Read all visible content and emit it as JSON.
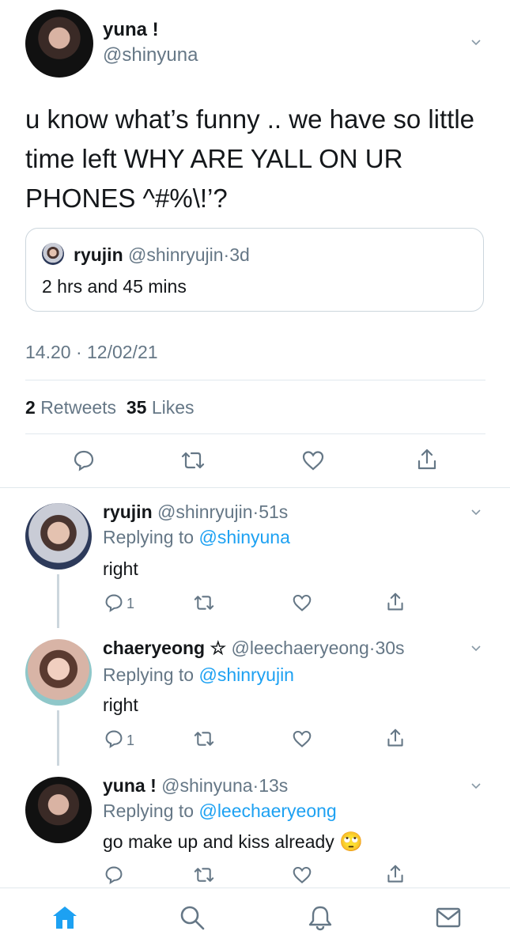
{
  "main_tweet": {
    "author_name": "yuna !",
    "author_handle": "@shinyuna",
    "text_line1": "u know what’s funny .. we have so little",
    "text_line2": "time left WHY ARE YALL ON UR",
    "text_line3": "PHONES ^#%\\!’?",
    "quoted": {
      "author_name": "ryujin",
      "author_handle": "@shinryujin",
      "sep": "·",
      "time": "3d",
      "text": "2 hrs and 45 mins"
    },
    "timestamp": "14.20 · 12/02/21",
    "retweets_count": "2",
    "retweets_label": "Retweets",
    "likes_count": "35",
    "likes_label": "Likes"
  },
  "replies": [
    {
      "author_name": "ryujin",
      "author_handle": "@shinryujin",
      "sep": "·",
      "time": "51s",
      "replying_prefix": "Replying to",
      "replying_to": "@shinyuna",
      "text": "right",
      "reply_count": "1"
    },
    {
      "author_name": "chaeryeong ☆",
      "author_handle": "@leechaeryeong",
      "sep": "·",
      "time": "30s",
      "replying_prefix": "Replying to",
      "replying_to": "@shinryujin",
      "text": "right",
      "reply_count": "1"
    },
    {
      "author_name": "yuna !",
      "author_handle": "@shinyuna",
      "sep": "·",
      "time": "13s",
      "replying_prefix": "Replying to",
      "replying_to": "@leechaeryeong",
      "text": "go make up and kiss already",
      "emoji": "🙄"
    }
  ],
  "tab_bar": {
    "items": [
      "home-icon",
      "search-icon",
      "notifications-icon",
      "messages-icon"
    ]
  },
  "colors": {
    "accent": "#1da1f2",
    "muted": "#657786",
    "divider": "#e1e8ed"
  }
}
